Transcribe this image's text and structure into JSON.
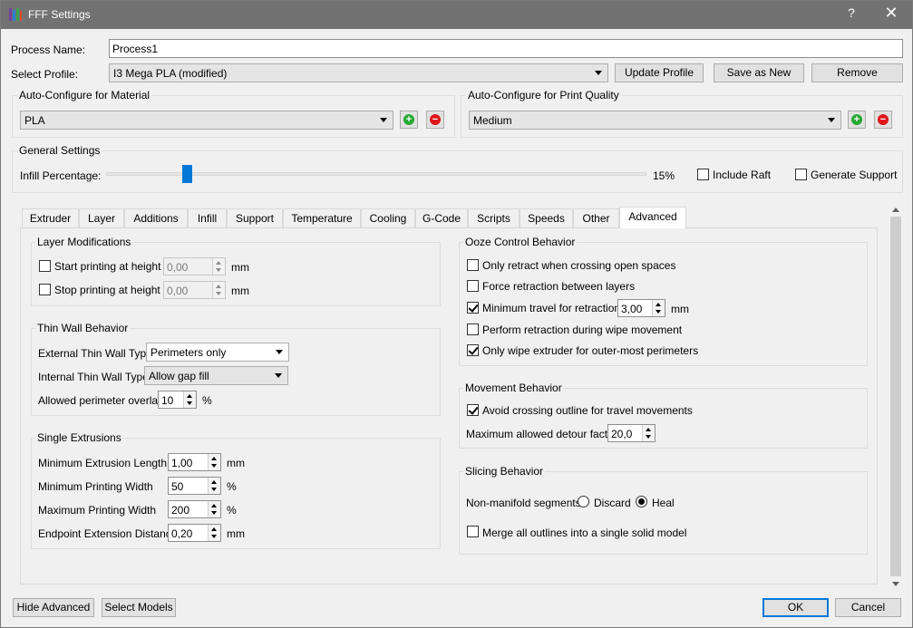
{
  "window": {
    "title": "FFF Settings",
    "help_glyph": "?",
    "close_glyph": "✕"
  },
  "process_name": {
    "label": "Process Name:",
    "value": "Process1"
  },
  "profile": {
    "label": "Select Profile:",
    "selected": "I3 Mega PLA (modified)",
    "update_button": "Update Profile",
    "save_as_new_button": "Save as New",
    "remove_button": "Remove"
  },
  "material": {
    "title": "Auto-Configure for Material",
    "selected": "PLA",
    "add_glyph": "+",
    "remove_glyph": "−"
  },
  "quality": {
    "title": "Auto-Configure for Print Quality",
    "selected": "Medium",
    "add_glyph": "+",
    "remove_glyph": "−"
  },
  "general": {
    "title": "General Settings",
    "infill_label": "Infill Percentage:",
    "infill_value": "15%",
    "infill_fraction": 0.15,
    "include_raft": {
      "label": "Include Raft",
      "checked": false
    },
    "generate_support": {
      "label": "Generate Support",
      "checked": false
    }
  },
  "tabs": [
    "Extruder",
    "Layer",
    "Additions",
    "Infill",
    "Support",
    "Temperature",
    "Cooling",
    "G-Code",
    "Scripts",
    "Speeds",
    "Other",
    "Advanced"
  ],
  "active_tab": "Advanced",
  "layer_mods": {
    "title": "Layer Modifications",
    "start": {
      "label": "Start printing at height",
      "value": "0,00",
      "unit": "mm",
      "checked": false
    },
    "stop": {
      "label": "Stop printing at height",
      "value": "0,00",
      "unit": "mm",
      "checked": false
    }
  },
  "thin_wall": {
    "title": "Thin Wall Behavior",
    "external_label": "External Thin Wall Type",
    "external_value": "Perimeters only",
    "internal_label": "Internal Thin Wall Type",
    "internal_value": "Allow gap fill",
    "overlap_label": "Allowed perimeter overlap",
    "overlap_value": "10",
    "overlap_unit": "%"
  },
  "single_extrusions": {
    "title": "Single Extrusions",
    "rows": [
      {
        "label": "Minimum Extrusion Length",
        "value": "1,00",
        "unit": "mm"
      },
      {
        "label": "Minimum Printing Width",
        "value": "50",
        "unit": "%"
      },
      {
        "label": "Maximum Printing Width",
        "value": "200",
        "unit": "%"
      },
      {
        "label": "Endpoint Extension Distance",
        "value": "0,20",
        "unit": "mm"
      }
    ]
  },
  "ooze": {
    "title": "Ooze Control Behavior",
    "only_retract": {
      "label": "Only retract when crossing open spaces",
      "checked": false
    },
    "force_retraction": {
      "label": "Force retraction between layers",
      "checked": false
    },
    "min_travel": {
      "label": "Minimum travel for retraction",
      "value": "3,00",
      "unit": "mm",
      "checked": true
    },
    "wipe_retraction": {
      "label": "Perform retraction during wipe movement",
      "checked": false
    },
    "only_wipe": {
      "label": "Only wipe extruder for outer-most perimeters",
      "checked": true
    }
  },
  "movement": {
    "title": "Movement Behavior",
    "avoid_crossing": {
      "label": "Avoid crossing outline for travel movements",
      "checked": true
    },
    "detour_label": "Maximum allowed detour factor",
    "detour_value": "20,0"
  },
  "slicing": {
    "title": "Slicing Behavior",
    "nonmanifold_label": "Non-manifold segments:",
    "discard": {
      "label": "Discard",
      "selected": false
    },
    "heal": {
      "label": "Heal",
      "selected": true
    },
    "merge": {
      "label": "Merge all outlines into a single solid model",
      "checked": false
    }
  },
  "footer": {
    "hide_advanced": "Hide Advanced",
    "select_models": "Select Models",
    "ok": "OK",
    "cancel": "Cancel"
  },
  "colors": {
    "titlebar": "#727272",
    "accent": "#0078d7",
    "add": "#2aa836",
    "remove": "#e0161b"
  }
}
